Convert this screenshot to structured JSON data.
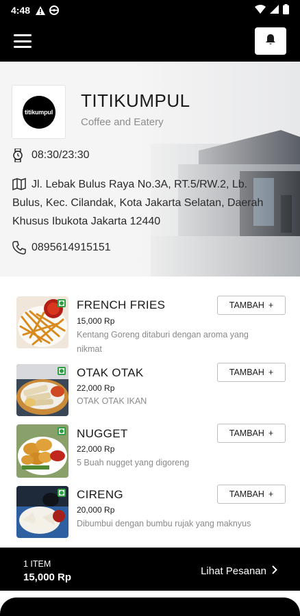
{
  "status": {
    "time": "4:48"
  },
  "store": {
    "name": "TITIKUMPUL",
    "subtitle": "Coffee and Eatery",
    "logo_text": "titikumpul",
    "hours": "08:30/23:30",
    "address": "Jl. Lebak Bulus Raya No.3A, RT.5/RW.2, Lb. Bulus, Kec. Cilandak, Kota Jakarta Selatan, Daerah Khusus Ibukota Jakarta 12440",
    "phone": "0895614915151"
  },
  "menu": [
    {
      "name": "FRENCH FRIES",
      "price": "15,000 Rp",
      "desc": "Kentang Goreng ditaburi dengan aroma yang nikmat",
      "add_label": "TAMBAH",
      "add_icon": "+"
    },
    {
      "name": "OTAK OTAK",
      "price": "22,000 Rp",
      "desc": "OTAK OTAK IKAN",
      "add_label": "TAMBAH",
      "add_icon": "+"
    },
    {
      "name": "NUGGET",
      "price": "22,000 Rp",
      "desc": "5 Buah nugget yang digoreng",
      "add_label": "TAMBAH",
      "add_icon": "+"
    },
    {
      "name": "CIRENG",
      "price": "20,000 Rp",
      "desc": "Dibumbui dengan bumbu rujak yang maknyus",
      "add_label": "TAMBAH",
      "add_icon": "+"
    }
  ],
  "cart": {
    "count": "1 ITEM",
    "total": "15,000 Rp",
    "action": "Lihat Pesanan"
  },
  "colors": {
    "primary": "#000000",
    "veg": "#2ea043",
    "muted": "#8a8a8a"
  }
}
